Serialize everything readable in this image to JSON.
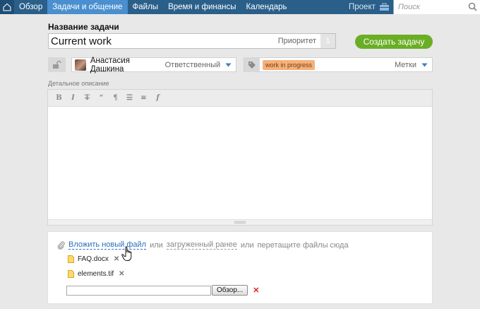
{
  "nav": {
    "items": [
      {
        "label": "Обзор",
        "active": false
      },
      {
        "label": "Задачи и общение",
        "active": true
      },
      {
        "label": "Файлы",
        "active": false
      },
      {
        "label": "Время и финансы",
        "active": false
      },
      {
        "label": "Календарь",
        "active": false
      }
    ],
    "project_label": "Проект",
    "search_placeholder": "Поиск",
    "colors": {
      "bar": "#2a5f8a",
      "active": "#4a8fcf"
    }
  },
  "task": {
    "title_label": "Название задачи",
    "title_value": "Current work",
    "priority_label": "Приоритет",
    "priority_value": "1",
    "create_button": "Создать задачу",
    "create_color": "#6aae25"
  },
  "responsible": {
    "name": "Анастасия Дашкина",
    "label": "Ответственный"
  },
  "tags": {
    "items": [
      "work in progress"
    ],
    "label": "Метки"
  },
  "description": {
    "label": "Детальное описание",
    "toolbar_icons": [
      "bold-icon",
      "italic-icon",
      "strikethrough-icon",
      "quote-icon",
      "paint-format-icon",
      "bullet-list-icon",
      "numbered-list-icon",
      "clear-format-icon"
    ],
    "toolbar_glyphs": [
      "B",
      "I",
      "T",
      "“",
      "¶",
      "☰",
      "≡",
      "f"
    ]
  },
  "attachments": {
    "attach_new": "Вложить новый файл",
    "or1": "или",
    "uploaded_before": "загруженный ранее",
    "or2": "или",
    "drag_hint": "перетащите файлы сюда",
    "files": [
      {
        "name": "FAQ.docx"
      },
      {
        "name": "elements.tif"
      }
    ],
    "browse_button": "Обзор...",
    "remove_glyph": "✕"
  }
}
